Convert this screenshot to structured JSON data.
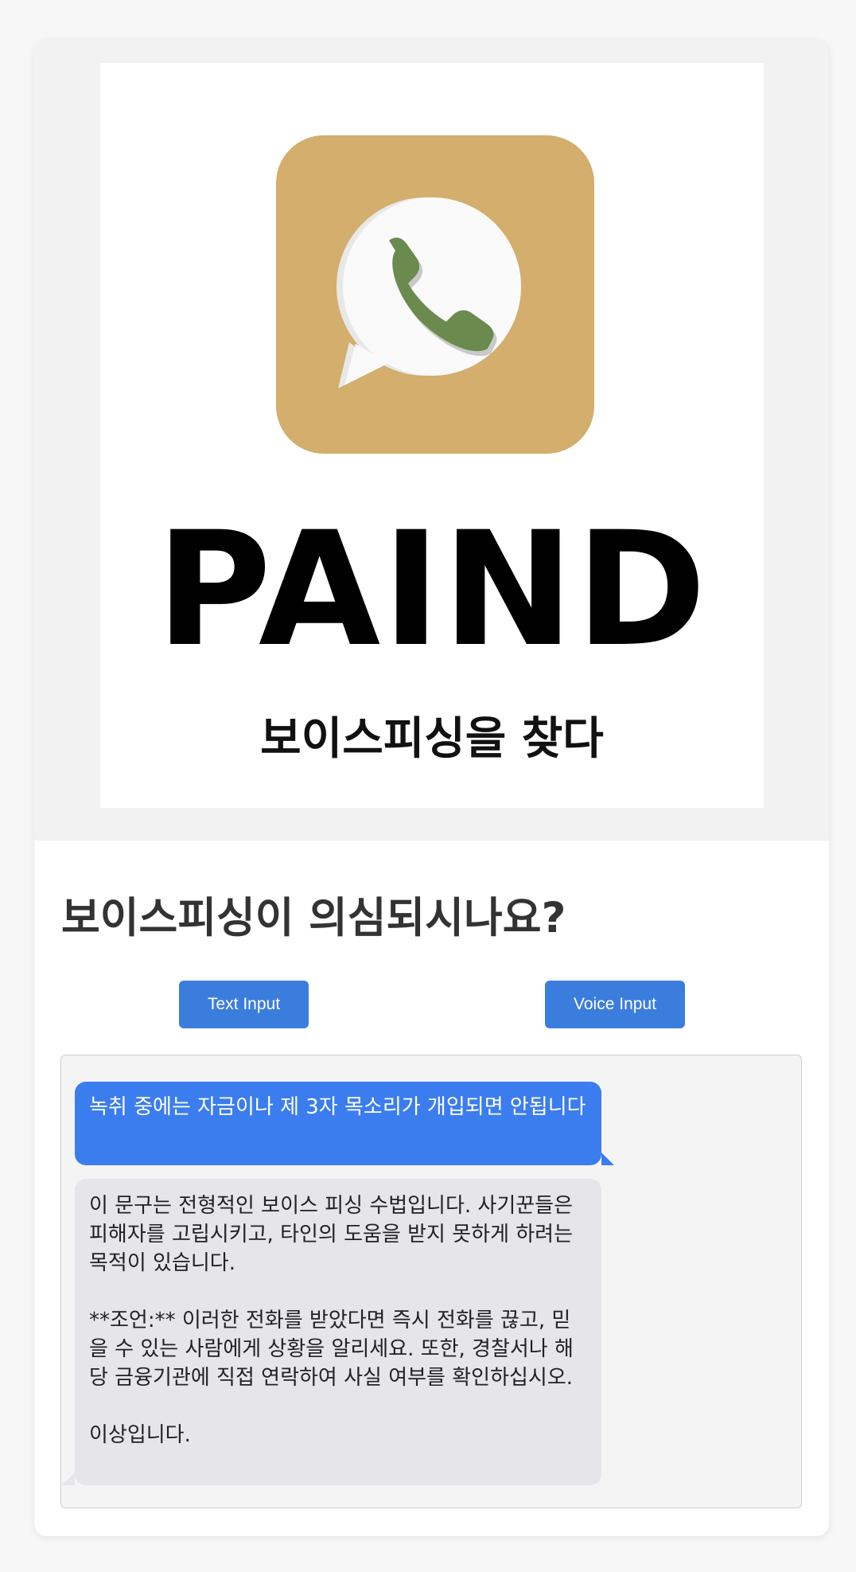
{
  "header": {
    "brand_name": "PAIND",
    "tagline": "보이스피싱을 찾다",
    "icon": "phone-chat-icon",
    "colors": {
      "icon_background": "#d4ae6c",
      "handset": "#6b8a4e",
      "bubble": "#ffffff"
    }
  },
  "main": {
    "question": "보이스피싱이 의심되시나요?",
    "buttons": {
      "text_input_label": "Text Input",
      "voice_input_label": "Voice Input"
    }
  },
  "chat": {
    "messages": [
      {
        "role": "user",
        "text": "녹취 중에는 자금이나 제 3자 목소리가 개입되면 안됩니다"
      },
      {
        "role": "assistant",
        "text": "이 문구는 전형적인 보이스 피싱 수법입니다. 사기꾼들은 피해자를 고립시키고, 타인의 도움을 받지 못하게 하려는 목적이 있습니다.\n\n**조언:** 이러한 전화를 받았다면 즉시 전화를 끊고, 믿을 수 있는 사람에게 상황을 알리세요. 또한, 경찰서나 해당 금융기관에 직접 연락하여 사실 여부를 확인하십시오.\n\n이상입니다."
      }
    ]
  },
  "theme": {
    "accent": "#3b7ddd",
    "user_bubble": "#3b7def",
    "bot_bubble": "#e5e5ea"
  }
}
